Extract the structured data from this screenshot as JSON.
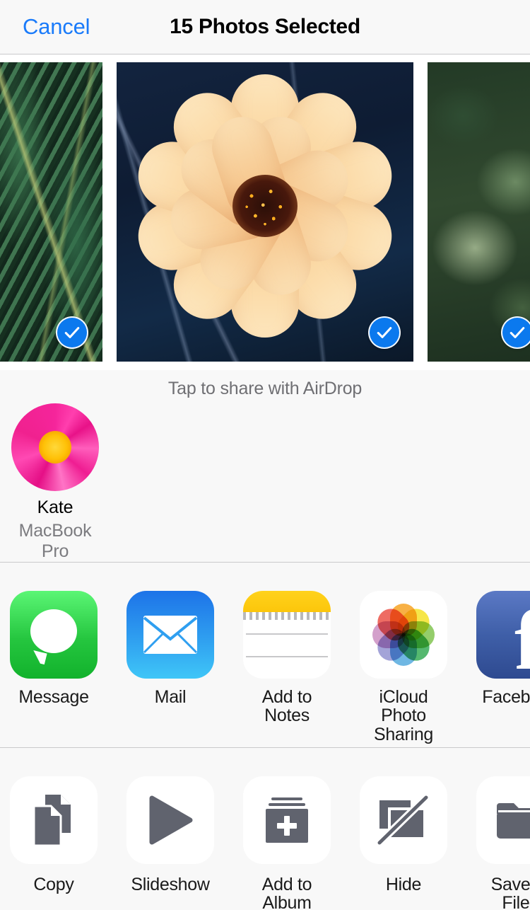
{
  "header": {
    "cancel_label": "Cancel",
    "title": "15 Photos Selected",
    "cancel_color": "#1a7bfa"
  },
  "photos": {
    "selected_count": 15,
    "items": [
      {
        "name": "fern-leaves-photo",
        "selected": true,
        "partial": "left"
      },
      {
        "name": "peach-dahlia-flower-photo",
        "selected": true,
        "partial": "none"
      },
      {
        "name": "round-green-leaves-photo",
        "selected": true,
        "partial": "right"
      }
    ],
    "check_color": "#0b79ee"
  },
  "airdrop": {
    "hint": "Tap to share with AirDrop",
    "contacts": [
      {
        "name": "Kate",
        "device": "MacBook Pro",
        "avatar": "pink-flower-avatar"
      }
    ]
  },
  "apps": {
    "items": [
      {
        "label": "Message",
        "icon": "messages-icon"
      },
      {
        "label": "Mail",
        "icon": "mail-icon"
      },
      {
        "label": "Add to Notes",
        "icon": "notes-icon"
      },
      {
        "label": "iCloud Photo Sharing",
        "icon": "photos-icon"
      },
      {
        "label": "Facebook",
        "icon": "facebook-icon"
      }
    ]
  },
  "actions": {
    "items": [
      {
        "label": "Copy",
        "icon": "copy-icon"
      },
      {
        "label": "Slideshow",
        "icon": "play-icon"
      },
      {
        "label": "Add to Album",
        "icon": "add-to-album-icon"
      },
      {
        "label": "Hide",
        "icon": "hide-icon"
      },
      {
        "label": "Save to Files",
        "icon": "folder-icon"
      }
    ]
  }
}
